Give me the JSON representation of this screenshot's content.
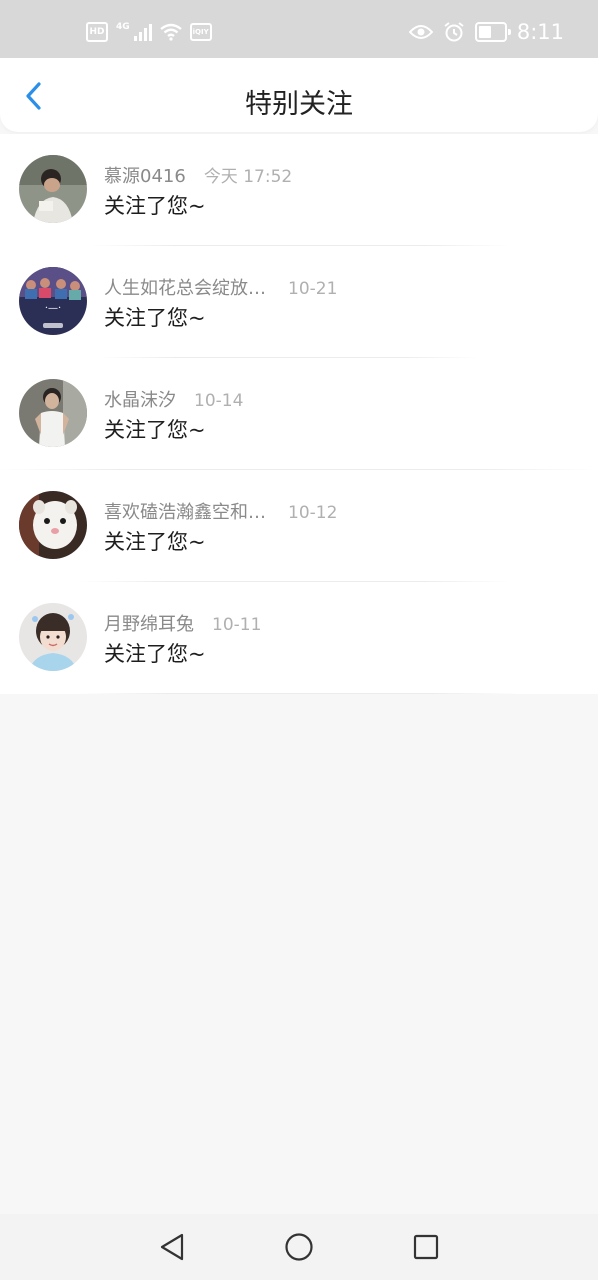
{
  "status_bar": {
    "hd": "HD",
    "network": "4G",
    "app_badge": "iQIY",
    "time": "8:11"
  },
  "header": {
    "title": "特别关注",
    "back_icon": "chevron-left-icon"
  },
  "colors": {
    "accent": "#2b8fe8",
    "title": "#222222",
    "name_gray": "#8a8a8a",
    "time_gray": "#b0b0b0",
    "status_bar_bg": "#d8d8d8",
    "page_bg": "#f8f7f8"
  },
  "items": [
    {
      "name": "慕源0416",
      "time": "今天 17:52",
      "action": "关注了您~"
    },
    {
      "name": "人生如花总会绽放…",
      "time": "10-21",
      "action": "关注了您~"
    },
    {
      "name": "水晶沫汐",
      "time": "10-14",
      "action": "关注了您~"
    },
    {
      "name": "喜欢磕浩瀚鑫空和…",
      "time": "10-12",
      "action": "关注了您~"
    },
    {
      "name": "月野绵耳兔",
      "time": "10-11",
      "action": "关注了您~"
    }
  ],
  "nav": {
    "back": "triangle-back-icon",
    "home": "circle-home-icon",
    "recents": "square-recents-icon"
  }
}
